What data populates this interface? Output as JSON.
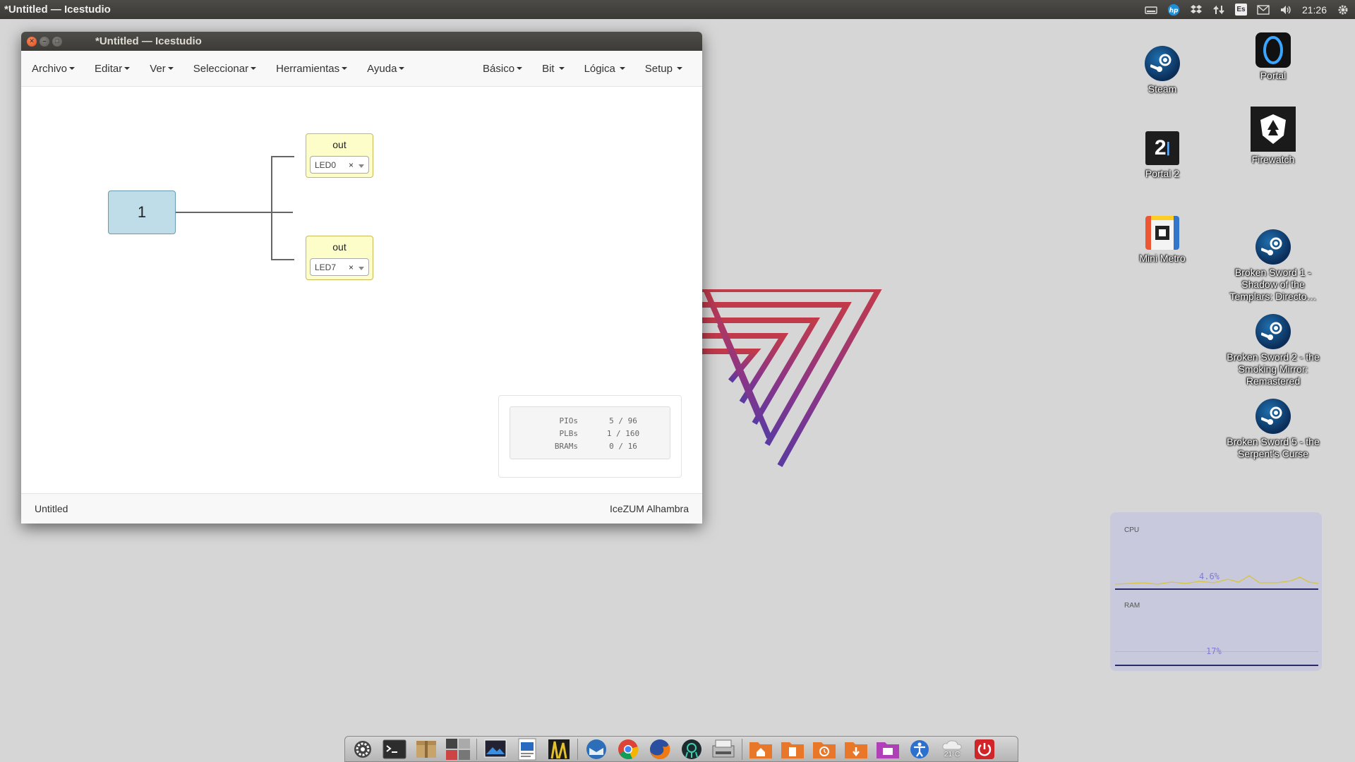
{
  "top_panel": {
    "active_window_title": "*Untitled — Icestudio",
    "tray": {
      "hp": "hp",
      "lang": "Es",
      "clock": "21:26"
    }
  },
  "desktop_icons": [
    {
      "label": "Steam"
    },
    {
      "label": "Portal"
    },
    {
      "label": "Portal 2"
    },
    {
      "label": "Firewatch"
    },
    {
      "label": "Mini Metro"
    },
    {
      "label": "Broken Sword 1 - Shadow of the Templars: Directo…"
    },
    {
      "label": "Broken Sword 2 - the Smoking Mirror: Remastered"
    },
    {
      "label": "Broken Sword 5 - the Serpent's Curse"
    }
  ],
  "window": {
    "title": "*Untitled — Icestudio",
    "menu_left": [
      {
        "label": "Archivo"
      },
      {
        "label": "Editar"
      },
      {
        "label": "Ver"
      },
      {
        "label": "Seleccionar"
      },
      {
        "label": "Herramientas"
      },
      {
        "label": "Ayuda"
      }
    ],
    "menu_right": [
      {
        "label": "Básico"
      },
      {
        "label": "Bit"
      },
      {
        "label": "Lógica"
      },
      {
        "label": "Setup"
      }
    ],
    "canvas": {
      "constant_block": {
        "value": "1"
      },
      "output_blocks": [
        {
          "label": "out",
          "pin": "LED0",
          "clear": "×"
        },
        {
          "label": "out",
          "pin": "LED7",
          "clear": "×"
        }
      ],
      "resources": [
        {
          "name": "PIOs",
          "value": "5 / 96"
        },
        {
          "name": "PLBs",
          "value": "1 / 160"
        },
        {
          "name": "BRAMs",
          "value": "0 / 16"
        }
      ]
    },
    "statusbar": {
      "file": "Untitled",
      "board": "IceZUM Alhambra"
    }
  },
  "sysmon": {
    "cpu_label": "CPU",
    "cpu_value": "4.6%",
    "ram_label": "RAM",
    "ram_value": "17%"
  },
  "dock": {
    "weather": "21°C"
  },
  "colors": {
    "panel": "#3c3b37",
    "close_button": "#df4a16",
    "constant_block": "#bfdde9",
    "output_block": "#fdfdc9"
  }
}
